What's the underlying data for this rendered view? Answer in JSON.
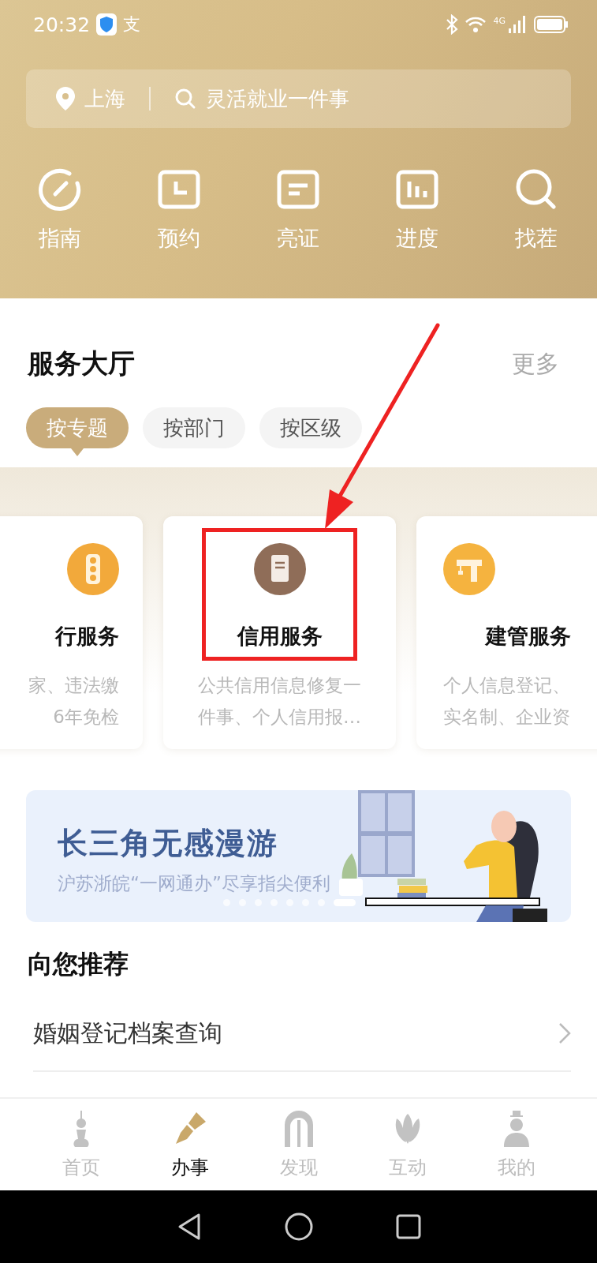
{
  "status_bar": {
    "time": "20:32",
    "app_glyph": "支",
    "network": "4G"
  },
  "search_bar": {
    "city": "上海",
    "placeholder": "灵活就业一件事"
  },
  "quick_actions": [
    {
      "kind": "gauge",
      "label": "指南"
    },
    {
      "kind": "clock",
      "label": "预约"
    },
    {
      "kind": "card",
      "label": "亮证"
    },
    {
      "kind": "chart",
      "label": "进度"
    },
    {
      "kind": "search",
      "label": "找茬"
    }
  ],
  "hall": {
    "title": "服务大厅",
    "more": "更多",
    "chips": [
      {
        "label": "按专题",
        "selected": true
      },
      {
        "label": "按部门",
        "selected": false
      },
      {
        "label": "按区级",
        "selected": false
      }
    ],
    "cards": [
      {
        "kind": "traffic",
        "title": "行服务",
        "lines": [
          "家、违法缴",
          "6年免检"
        ]
      },
      {
        "kind": "document",
        "title": "信用服务",
        "lines": [
          "公共信用信息修复一件事、个人信用报…"
        ]
      },
      {
        "kind": "crane",
        "title": "建管服务",
        "lines": [
          "个人信息登记、",
          "实名制、企业资"
        ]
      }
    ]
  },
  "banner": {
    "title": "长三角无感漫游",
    "subtitle": "沪苏浙皖“一网通办”尽享指尖便利",
    "pager": [
      {
        "selected": false
      },
      {
        "selected": false
      },
      {
        "selected": false
      },
      {
        "selected": false
      },
      {
        "selected": false
      },
      {
        "selected": false
      },
      {
        "selected": false
      },
      {
        "selected": true
      }
    ]
  },
  "recommend": {
    "title": "向您推荐",
    "items": [
      "婚姻登记档案查询"
    ]
  },
  "tab_bar": [
    {
      "kind": "tower",
      "label": "首页",
      "selected": false
    },
    {
      "kind": "pen",
      "label": "办事",
      "selected": true
    },
    {
      "kind": "arch",
      "label": "发现",
      "selected": false
    },
    {
      "kind": "flower",
      "label": "互动",
      "selected": false
    },
    {
      "kind": "person",
      "label": "我的",
      "selected": false
    }
  ]
}
